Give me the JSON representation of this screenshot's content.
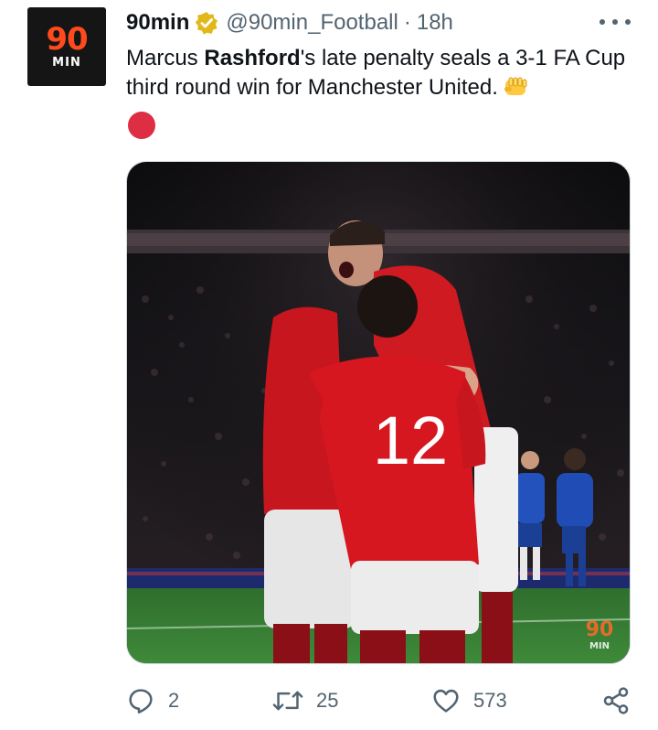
{
  "account": {
    "avatar_number": "90",
    "avatar_word": "MIN",
    "display_name": "90min",
    "handle": "@90min_Football",
    "separator": "·",
    "time": "18h"
  },
  "tweet": {
    "text_before": "Marcus ",
    "text_bold": "Rashford",
    "text_after": "'s late penalty seals a 3-1 FA Cup third round win for Manchester United."
  },
  "media": {
    "shirt_number": "12",
    "watermark_number": "90",
    "watermark_word": "MIN"
  },
  "actions": {
    "replies": "2",
    "retweets": "25",
    "likes": "573"
  },
  "colors": {
    "accent_orange": "#ff4a1c",
    "verified_gold": "#e2b719",
    "red_circle": "#dd2e44",
    "secondary_text": "#536471"
  }
}
